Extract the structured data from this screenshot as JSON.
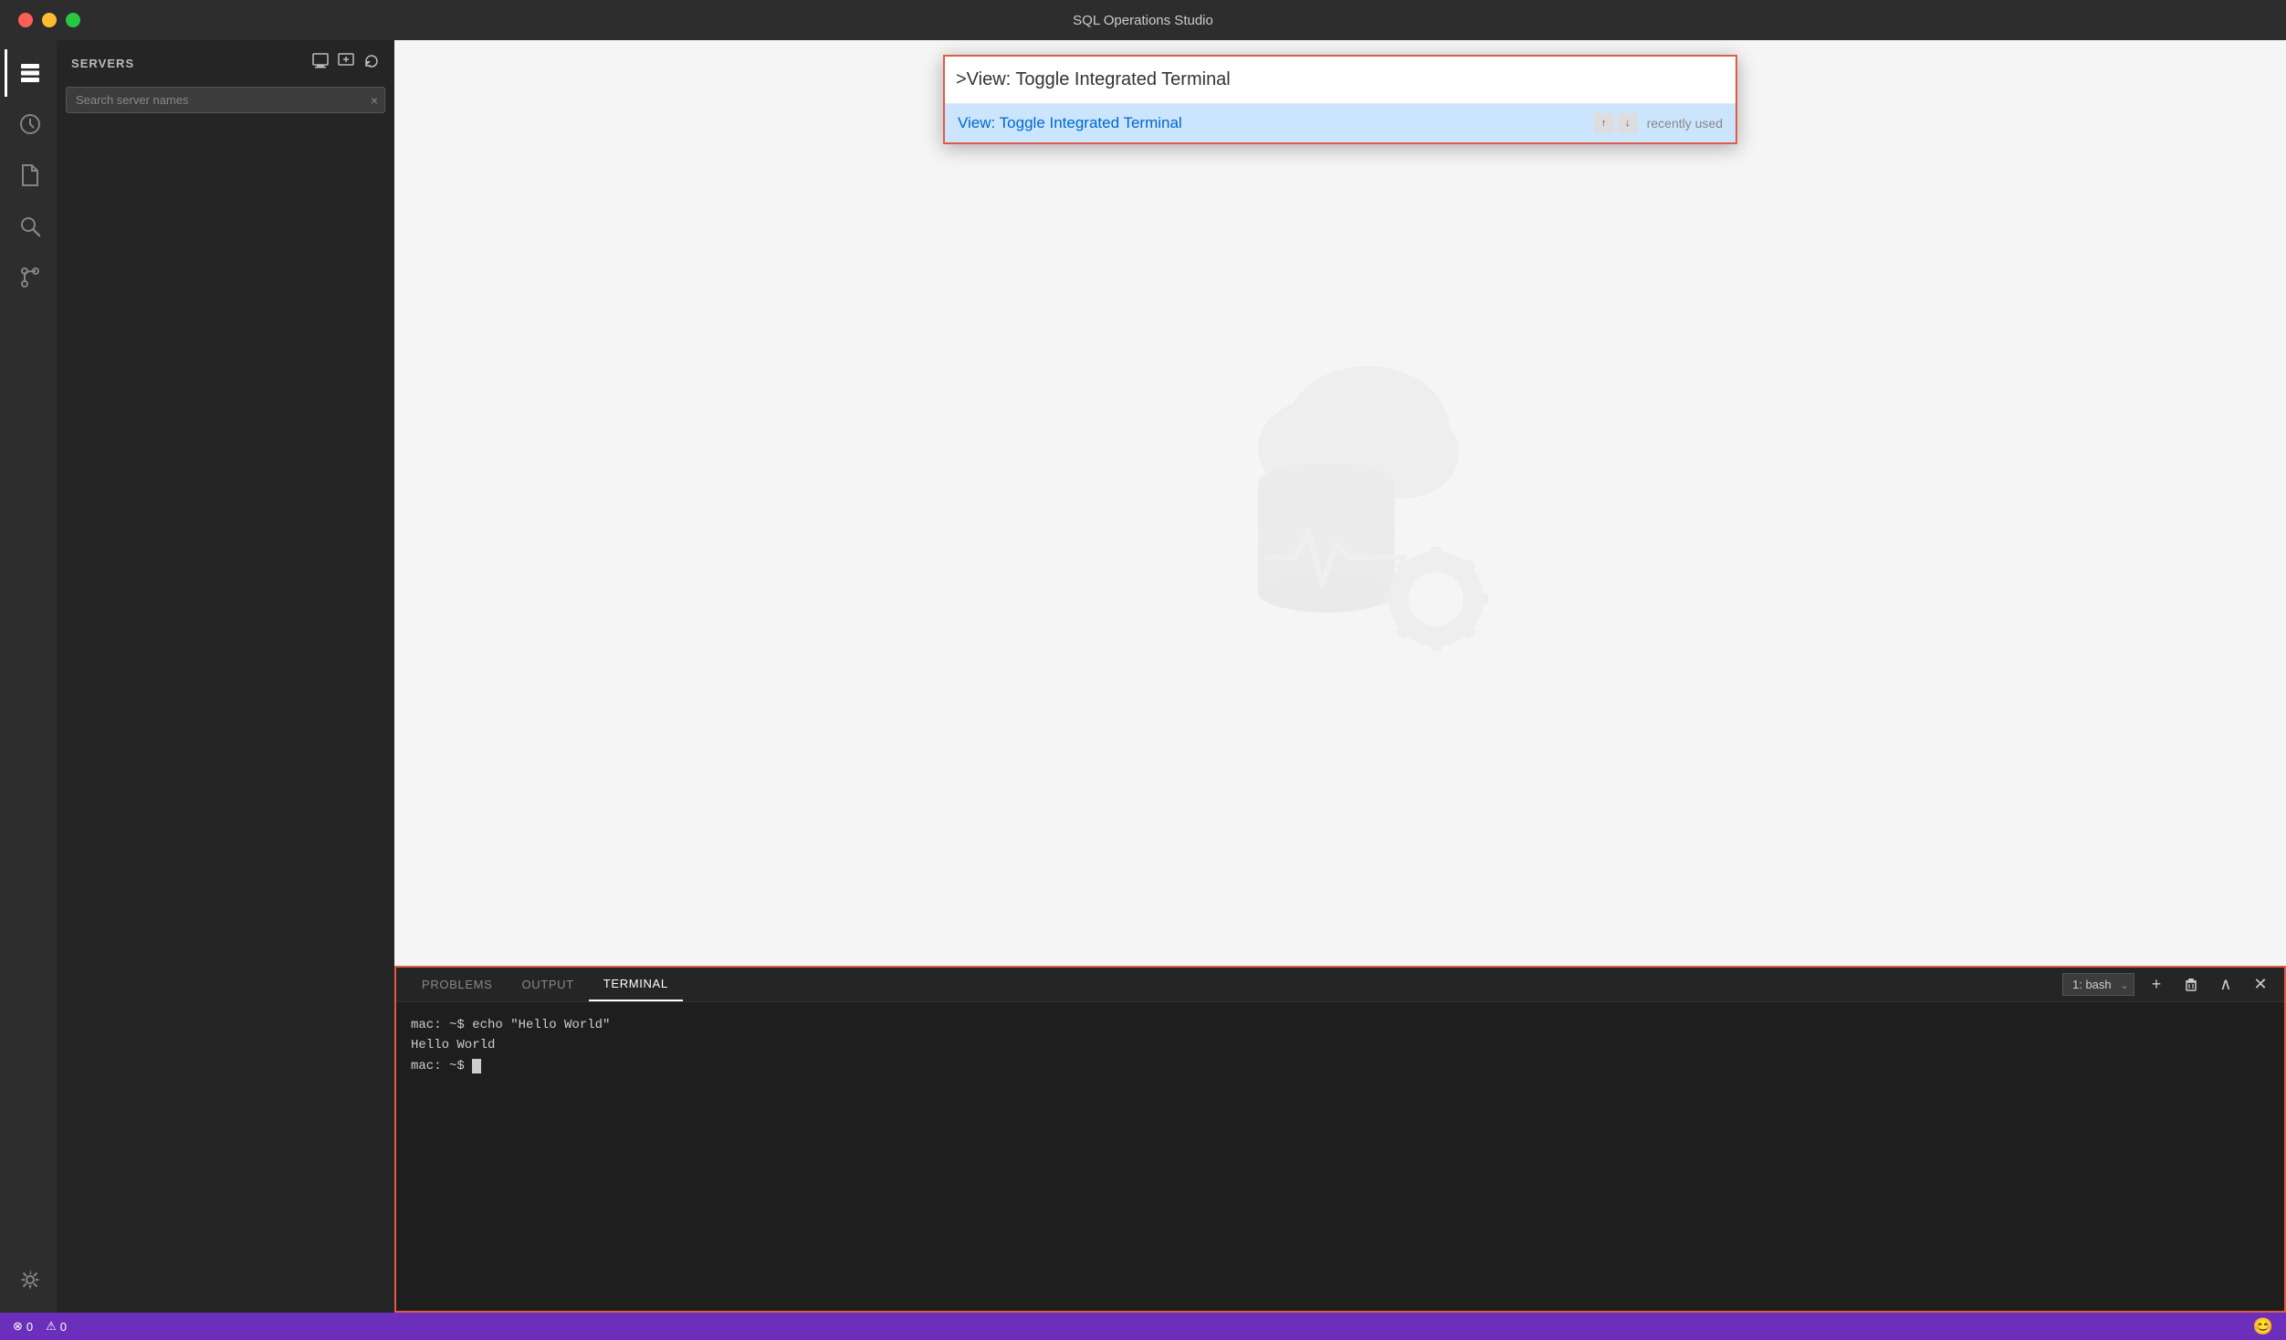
{
  "window": {
    "title": "SQL Operations Studio"
  },
  "traffic_lights": {
    "close": "close",
    "minimize": "minimize",
    "maximize": "maximize"
  },
  "activity_bar": {
    "icons": [
      {
        "name": "servers-icon",
        "symbol": "⊞",
        "active": true
      },
      {
        "name": "history-icon",
        "symbol": "🕐",
        "active": false
      },
      {
        "name": "file-icon",
        "symbol": "📄",
        "active": false
      },
      {
        "name": "search-icon",
        "symbol": "🔍",
        "active": false
      },
      {
        "name": "git-icon",
        "symbol": "⎇",
        "active": false
      }
    ],
    "bottom_icon": {
      "name": "settings-icon",
      "symbol": "⚙"
    }
  },
  "sidebar": {
    "title": "SERVERS",
    "header_actions": [
      {
        "name": "new-connection-icon",
        "symbol": "⊡"
      },
      {
        "name": "add-server-icon",
        "symbol": "⊞"
      },
      {
        "name": "refresh-icon",
        "symbol": "↻"
      }
    ],
    "search_placeholder": "Search server names",
    "search_clear": "×"
  },
  "command_palette": {
    "input_value": ">View: Toggle Integrated Terminal",
    "result_label": "View: Toggle Integrated Terminal",
    "result_tag": "recently used",
    "nav_up": "↑",
    "nav_down": "↓"
  },
  "terminal": {
    "tabs": [
      {
        "label": "PROBLEMS",
        "active": false
      },
      {
        "label": "OUTPUT",
        "active": false
      },
      {
        "label": "TERMINAL",
        "active": true
      }
    ],
    "select_option": "1: bash",
    "controls": [
      {
        "name": "add-terminal-btn",
        "symbol": "+"
      },
      {
        "name": "delete-terminal-btn",
        "symbol": "🗑"
      },
      {
        "name": "maximize-terminal-btn",
        "symbol": "∧"
      },
      {
        "name": "close-terminal-btn",
        "symbol": "✕"
      }
    ],
    "lines": [
      "mac: ~$ echo \"Hello World\"",
      "Hello World",
      "mac: ~$ "
    ],
    "cursor": ""
  },
  "status_bar": {
    "items": [
      {
        "name": "error-count",
        "symbol": "⊗",
        "value": "0"
      },
      {
        "name": "warning-count",
        "symbol": "⚠",
        "value": "0"
      }
    ],
    "right_icon": "😊"
  }
}
